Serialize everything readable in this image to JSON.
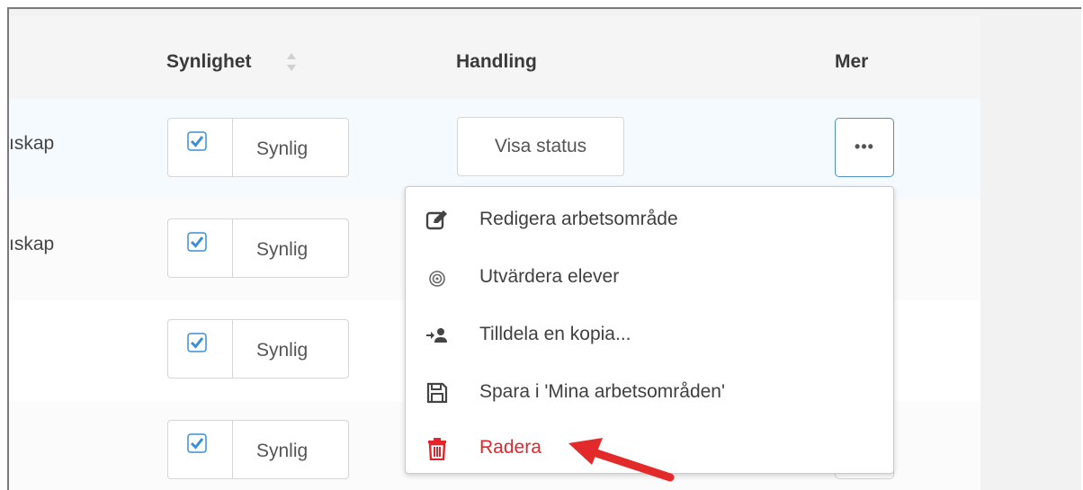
{
  "table": {
    "headers": {
      "visibility": "Synlighet",
      "action": "Handling",
      "more": "Mer"
    },
    "rows": [
      {
        "subject_fragment": "ıskap",
        "visibility_label": "Synlig",
        "visibility_checked": true,
        "action_label": "Visa status",
        "more_label": "•••"
      },
      {
        "subject_fragment": "ıskap",
        "visibility_label": "Synlig",
        "visibility_checked": true
      },
      {
        "subject_fragment": "",
        "visibility_label": "Synlig",
        "visibility_checked": true
      },
      {
        "subject_fragment": "",
        "visibility_label": "Synlig",
        "visibility_checked": true
      }
    ]
  },
  "menu": {
    "items": [
      {
        "label": "Redigera arbetsområde",
        "icon": "edit-icon"
      },
      {
        "label": "Utvärdera elever",
        "icon": "target-icon"
      },
      {
        "label": "Tilldela en kopia...",
        "icon": "assign-user-icon"
      },
      {
        "label": "Spara i 'Mina arbetsområden'",
        "icon": "save-icon"
      },
      {
        "label": "Radera",
        "icon": "trash-icon"
      }
    ]
  },
  "colors": {
    "danger": "#e0262c",
    "checkbox_blue": "#3b8fd6",
    "focus_border": "#4a90c4",
    "annotation_arrow": "#e32a2a"
  }
}
